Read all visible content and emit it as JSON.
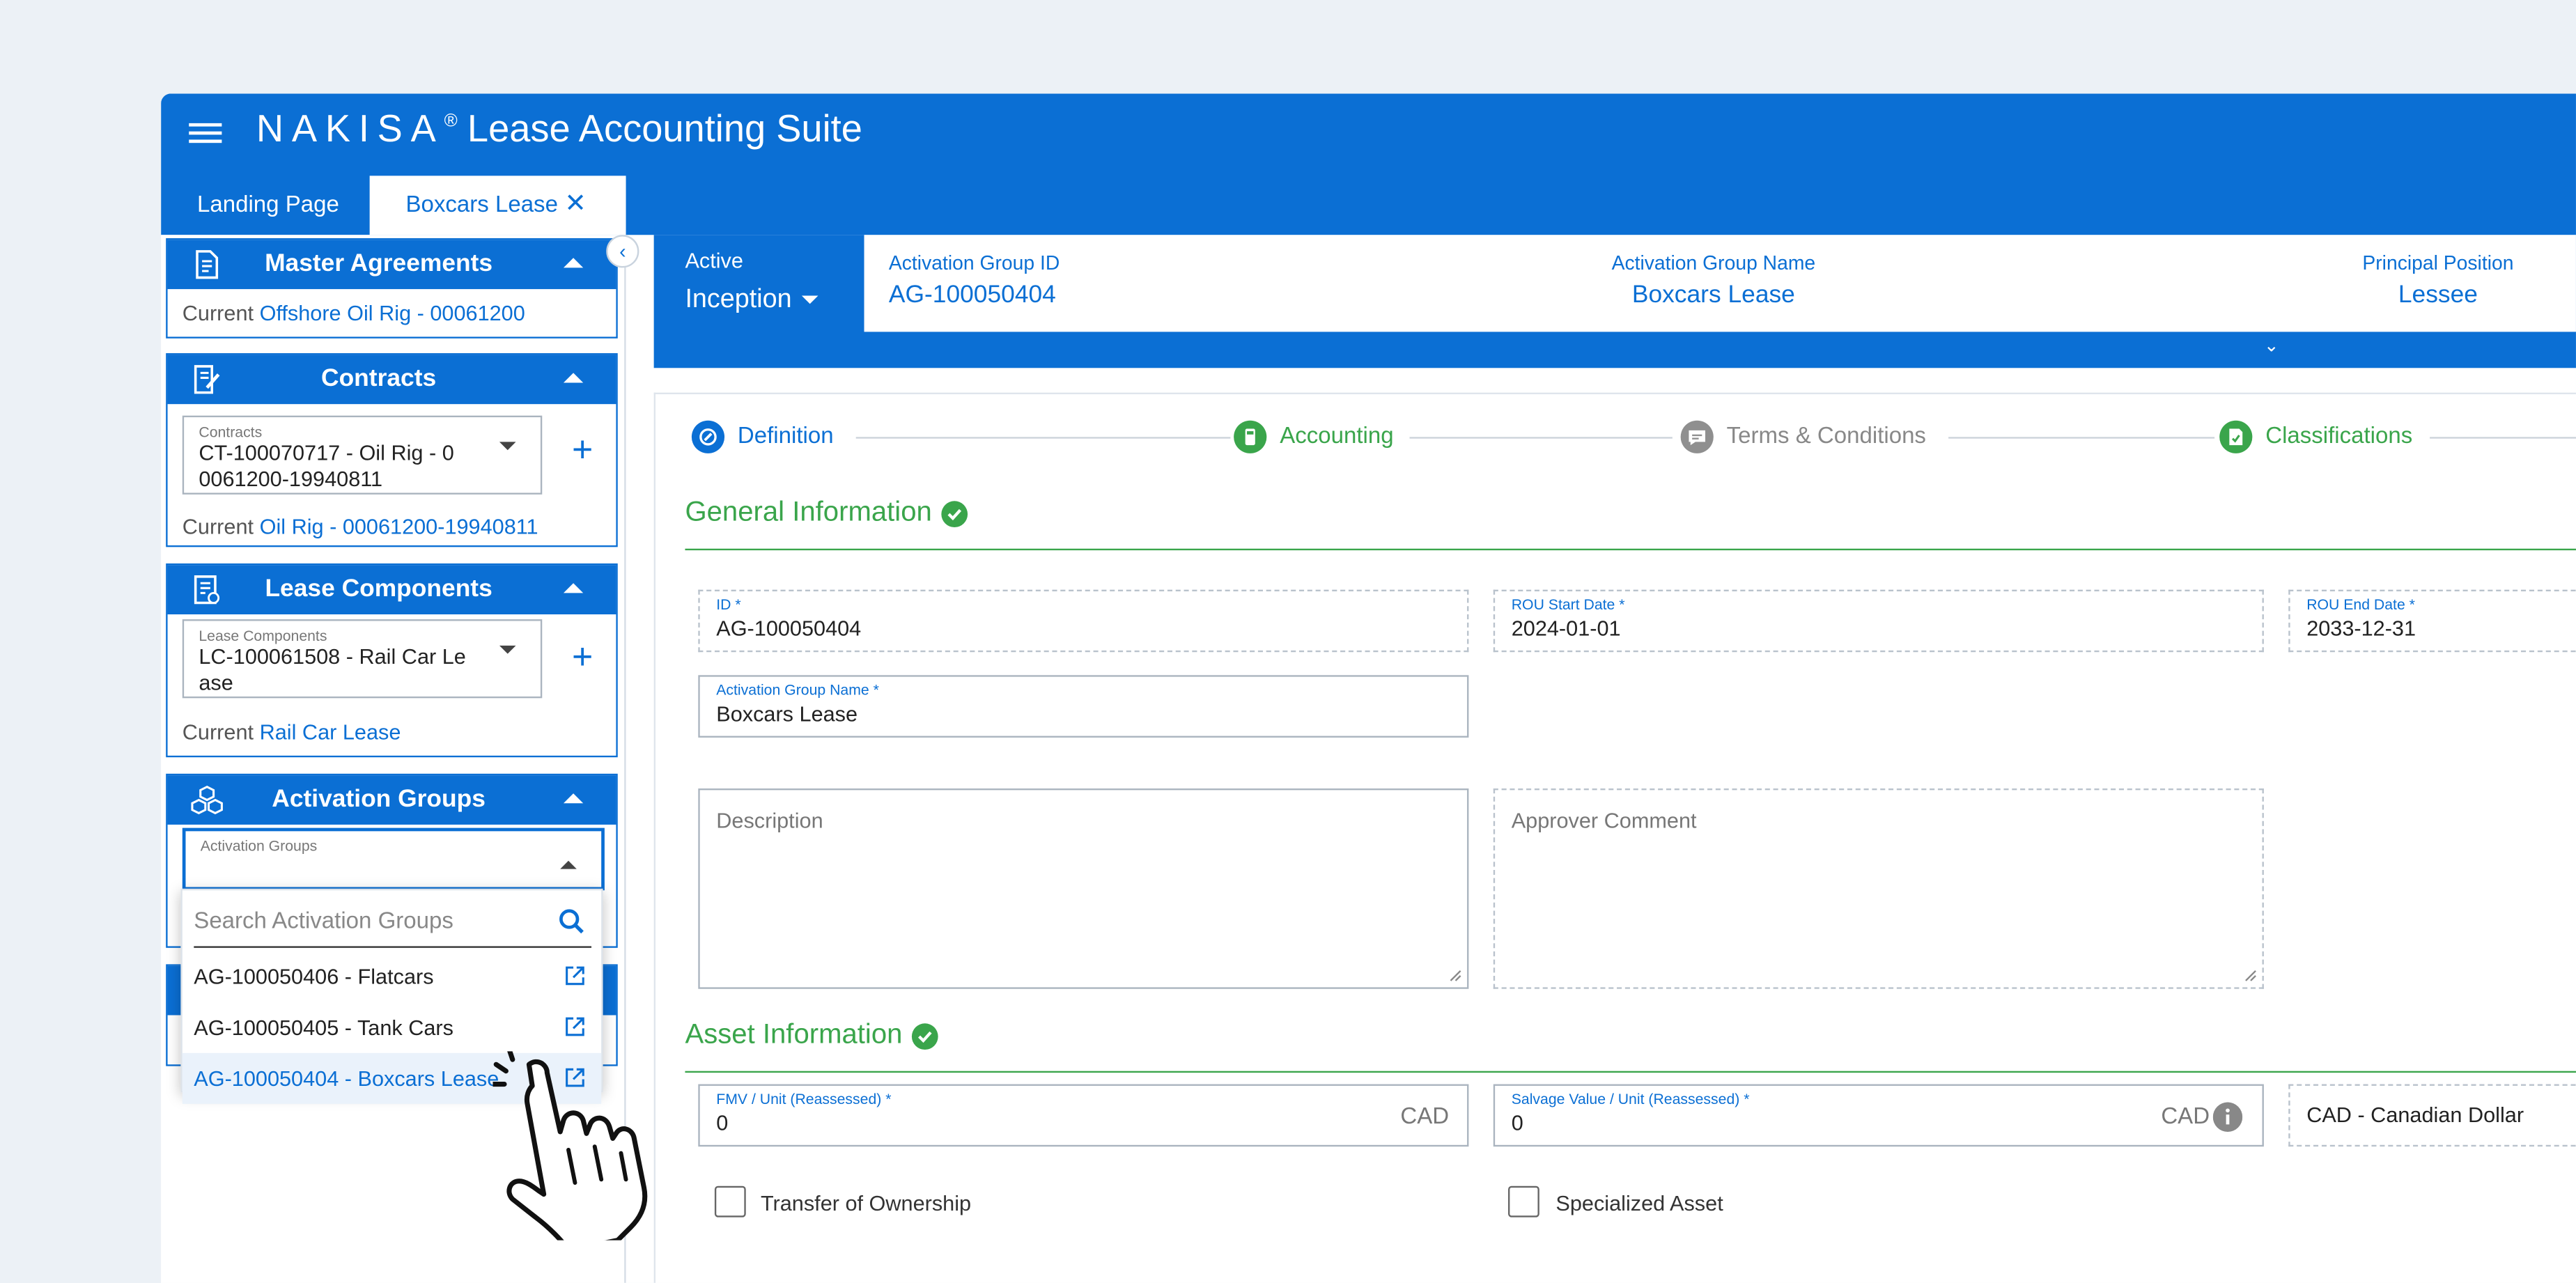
{
  "app": {
    "brand_name": "NAKISA",
    "registered": "®",
    "suite": "Lease Accounting Suite"
  },
  "tabs": {
    "landing": "Landing Page",
    "active": "Boxcars Lease",
    "close_symbol": "✕"
  },
  "sidebar": {
    "collapse_symbol": "‹",
    "current_label": "Current",
    "master_agreements": {
      "title": "Master Agreements",
      "current": "Offshore Oil Rig - 00061200"
    },
    "contracts": {
      "title": "Contracts",
      "select_label": "Contracts",
      "select_line1": "CT-100070717 - Oil Rig - 0",
      "select_line2": "0061200-19940811",
      "current": "Oil Rig - 00061200-19940811",
      "add_symbol": "+"
    },
    "lease_components": {
      "title": "Lease Components",
      "select_label": "Lease Components",
      "select_line1": "LC-100061508 - Rail Car Le",
      "select_line2": "ase",
      "current": "Rail Car Lease",
      "add_symbol": "+"
    },
    "activation_groups": {
      "title": "Activation Groups",
      "select_label": "Activation Groups",
      "search_placeholder": "Search Activation Groups",
      "items": [
        "AG-100050406 - Flatcars",
        "AG-100050405 - Tank Cars",
        "AG-100050404 - Boxcars Lease"
      ],
      "selected_index": 2
    }
  },
  "context": {
    "state_label": "Active",
    "state_value": "Inception",
    "fields": [
      {
        "label": "Activation Group ID",
        "value": "AG-100050404"
      },
      {
        "label": "Activation Group Name",
        "value": "Boxcars Lease"
      },
      {
        "label": "Principal Position",
        "value": "Lessee"
      }
    ],
    "expand_symbol": "⌄"
  },
  "steps": [
    "Definition",
    "Accounting",
    "Terms & Conditions",
    "Classifications"
  ],
  "general_information": {
    "title": "General Information",
    "id": {
      "label": "ID *",
      "value": "AG-100050404"
    },
    "rou_start": {
      "label": "ROU Start Date *",
      "value": "2024-01-01"
    },
    "rou_end": {
      "label": "ROU End Date *",
      "value": "2033-12-31"
    },
    "name": {
      "label": "Activation Group Name *",
      "value": "Boxcars Lease"
    },
    "description": {
      "placeholder": "Description"
    },
    "approver_comment": {
      "placeholder": "Approver Comment"
    }
  },
  "asset_information": {
    "title": "Asset Information",
    "fmv": {
      "label": "FMV / Unit (Reassessed) *",
      "value": "0",
      "unit": "CAD"
    },
    "salvage": {
      "label": "Salvage Value / Unit (Reassessed) *",
      "value": "0",
      "unit": "CAD"
    },
    "currency": {
      "value": "CAD - Canadian Dollar"
    },
    "transfer_of_ownership": "Transfer of Ownership",
    "specialized_asset": "Specialized Asset"
  },
  "colors": {
    "primary": "#0b6fd4",
    "success": "#3aa54b",
    "background": "#ecf1f6"
  }
}
